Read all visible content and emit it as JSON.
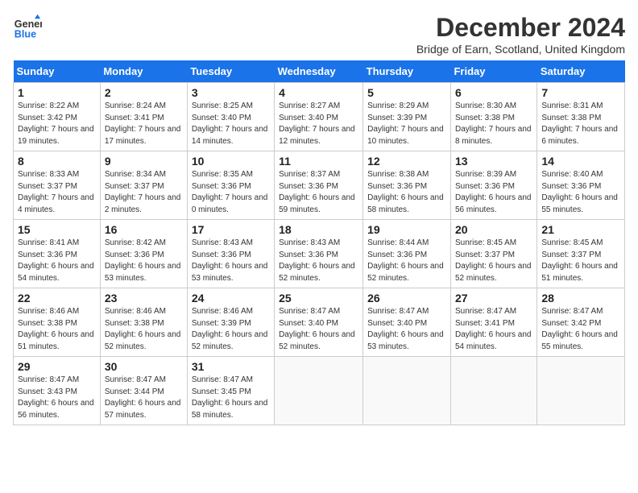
{
  "header": {
    "logo_line1": "General",
    "logo_line2": "Blue",
    "month_title": "December 2024",
    "location": "Bridge of Earn, Scotland, United Kingdom"
  },
  "days_of_week": [
    "Sunday",
    "Monday",
    "Tuesday",
    "Wednesday",
    "Thursday",
    "Friday",
    "Saturday"
  ],
  "weeks": [
    [
      {
        "day": "1",
        "sunrise": "Sunrise: 8:22 AM",
        "sunset": "Sunset: 3:42 PM",
        "daylight": "Daylight: 7 hours and 19 minutes."
      },
      {
        "day": "2",
        "sunrise": "Sunrise: 8:24 AM",
        "sunset": "Sunset: 3:41 PM",
        "daylight": "Daylight: 7 hours and 17 minutes."
      },
      {
        "day": "3",
        "sunrise": "Sunrise: 8:25 AM",
        "sunset": "Sunset: 3:40 PM",
        "daylight": "Daylight: 7 hours and 14 minutes."
      },
      {
        "day": "4",
        "sunrise": "Sunrise: 8:27 AM",
        "sunset": "Sunset: 3:40 PM",
        "daylight": "Daylight: 7 hours and 12 minutes."
      },
      {
        "day": "5",
        "sunrise": "Sunrise: 8:29 AM",
        "sunset": "Sunset: 3:39 PM",
        "daylight": "Daylight: 7 hours and 10 minutes."
      },
      {
        "day": "6",
        "sunrise": "Sunrise: 8:30 AM",
        "sunset": "Sunset: 3:38 PM",
        "daylight": "Daylight: 7 hours and 8 minutes."
      },
      {
        "day": "7",
        "sunrise": "Sunrise: 8:31 AM",
        "sunset": "Sunset: 3:38 PM",
        "daylight": "Daylight: 7 hours and 6 minutes."
      }
    ],
    [
      {
        "day": "8",
        "sunrise": "Sunrise: 8:33 AM",
        "sunset": "Sunset: 3:37 PM",
        "daylight": "Daylight: 7 hours and 4 minutes."
      },
      {
        "day": "9",
        "sunrise": "Sunrise: 8:34 AM",
        "sunset": "Sunset: 3:37 PM",
        "daylight": "Daylight: 7 hours and 2 minutes."
      },
      {
        "day": "10",
        "sunrise": "Sunrise: 8:35 AM",
        "sunset": "Sunset: 3:36 PM",
        "daylight": "Daylight: 7 hours and 0 minutes."
      },
      {
        "day": "11",
        "sunrise": "Sunrise: 8:37 AM",
        "sunset": "Sunset: 3:36 PM",
        "daylight": "Daylight: 6 hours and 59 minutes."
      },
      {
        "day": "12",
        "sunrise": "Sunrise: 8:38 AM",
        "sunset": "Sunset: 3:36 PM",
        "daylight": "Daylight: 6 hours and 58 minutes."
      },
      {
        "day": "13",
        "sunrise": "Sunrise: 8:39 AM",
        "sunset": "Sunset: 3:36 PM",
        "daylight": "Daylight: 6 hours and 56 minutes."
      },
      {
        "day": "14",
        "sunrise": "Sunrise: 8:40 AM",
        "sunset": "Sunset: 3:36 PM",
        "daylight": "Daylight: 6 hours and 55 minutes."
      }
    ],
    [
      {
        "day": "15",
        "sunrise": "Sunrise: 8:41 AM",
        "sunset": "Sunset: 3:36 PM",
        "daylight": "Daylight: 6 hours and 54 minutes."
      },
      {
        "day": "16",
        "sunrise": "Sunrise: 8:42 AM",
        "sunset": "Sunset: 3:36 PM",
        "daylight": "Daylight: 6 hours and 53 minutes."
      },
      {
        "day": "17",
        "sunrise": "Sunrise: 8:43 AM",
        "sunset": "Sunset: 3:36 PM",
        "daylight": "Daylight: 6 hours and 53 minutes."
      },
      {
        "day": "18",
        "sunrise": "Sunrise: 8:43 AM",
        "sunset": "Sunset: 3:36 PM",
        "daylight": "Daylight: 6 hours and 52 minutes."
      },
      {
        "day": "19",
        "sunrise": "Sunrise: 8:44 AM",
        "sunset": "Sunset: 3:36 PM",
        "daylight": "Daylight: 6 hours and 52 minutes."
      },
      {
        "day": "20",
        "sunrise": "Sunrise: 8:45 AM",
        "sunset": "Sunset: 3:37 PM",
        "daylight": "Daylight: 6 hours and 52 minutes."
      },
      {
        "day": "21",
        "sunrise": "Sunrise: 8:45 AM",
        "sunset": "Sunset: 3:37 PM",
        "daylight": "Daylight: 6 hours and 51 minutes."
      }
    ],
    [
      {
        "day": "22",
        "sunrise": "Sunrise: 8:46 AM",
        "sunset": "Sunset: 3:38 PM",
        "daylight": "Daylight: 6 hours and 51 minutes."
      },
      {
        "day": "23",
        "sunrise": "Sunrise: 8:46 AM",
        "sunset": "Sunset: 3:38 PM",
        "daylight": "Daylight: 6 hours and 52 minutes."
      },
      {
        "day": "24",
        "sunrise": "Sunrise: 8:46 AM",
        "sunset": "Sunset: 3:39 PM",
        "daylight": "Daylight: 6 hours and 52 minutes."
      },
      {
        "day": "25",
        "sunrise": "Sunrise: 8:47 AM",
        "sunset": "Sunset: 3:40 PM",
        "daylight": "Daylight: 6 hours and 52 minutes."
      },
      {
        "day": "26",
        "sunrise": "Sunrise: 8:47 AM",
        "sunset": "Sunset: 3:40 PM",
        "daylight": "Daylight: 6 hours and 53 minutes."
      },
      {
        "day": "27",
        "sunrise": "Sunrise: 8:47 AM",
        "sunset": "Sunset: 3:41 PM",
        "daylight": "Daylight: 6 hours and 54 minutes."
      },
      {
        "day": "28",
        "sunrise": "Sunrise: 8:47 AM",
        "sunset": "Sunset: 3:42 PM",
        "daylight": "Daylight: 6 hours and 55 minutes."
      }
    ],
    [
      {
        "day": "29",
        "sunrise": "Sunrise: 8:47 AM",
        "sunset": "Sunset: 3:43 PM",
        "daylight": "Daylight: 6 hours and 56 minutes."
      },
      {
        "day": "30",
        "sunrise": "Sunrise: 8:47 AM",
        "sunset": "Sunset: 3:44 PM",
        "daylight": "Daylight: 6 hours and 57 minutes."
      },
      {
        "day": "31",
        "sunrise": "Sunrise: 8:47 AM",
        "sunset": "Sunset: 3:45 PM",
        "daylight": "Daylight: 6 hours and 58 minutes."
      },
      null,
      null,
      null,
      null
    ]
  ]
}
